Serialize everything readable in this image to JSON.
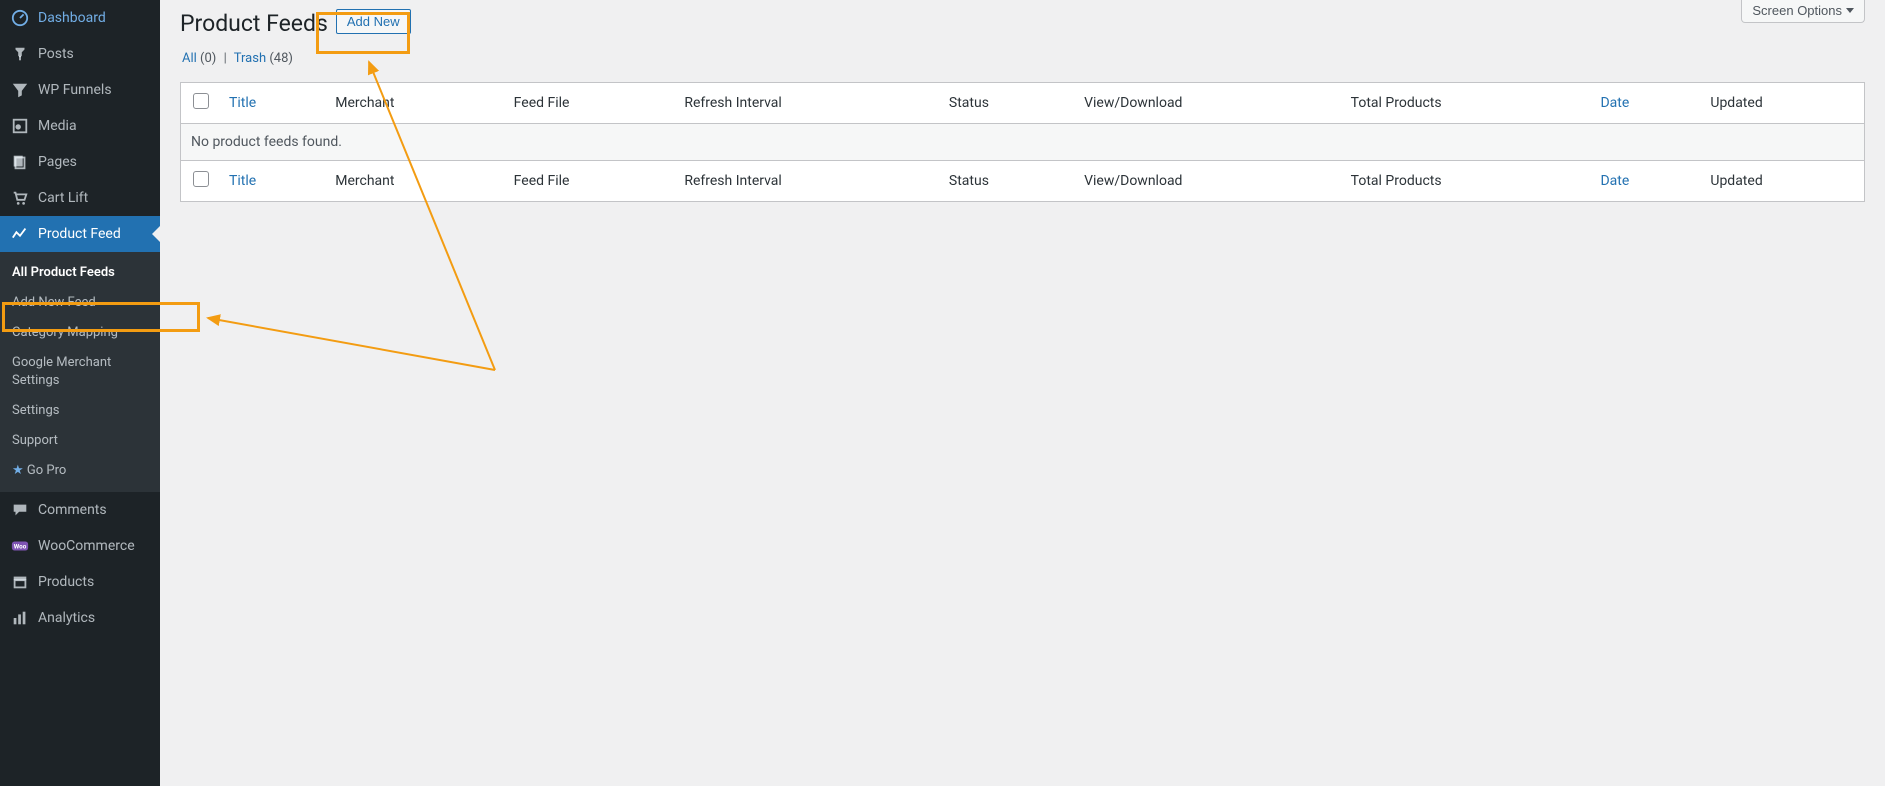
{
  "sidebar": {
    "items": [
      {
        "id": "dashboard",
        "label": "Dashboard",
        "icon": "dashboard"
      },
      {
        "id": "posts",
        "label": "Posts",
        "icon": "pushpin"
      },
      {
        "id": "wpfunnels",
        "label": "WP Funnels",
        "icon": "funnel"
      },
      {
        "id": "media",
        "label": "Media",
        "icon": "media"
      },
      {
        "id": "pages",
        "label": "Pages",
        "icon": "page"
      },
      {
        "id": "cartlift",
        "label": "Cart Lift",
        "icon": "cart"
      },
      {
        "id": "productfeed",
        "label": "Product Feed",
        "icon": "chart",
        "active": true
      },
      {
        "id": "comments",
        "label": "Comments",
        "icon": "comment"
      },
      {
        "id": "woocommerce",
        "label": "WooCommerce",
        "icon": "woo"
      },
      {
        "id": "products",
        "label": "Products",
        "icon": "archive"
      },
      {
        "id": "analytics",
        "label": "Analytics",
        "icon": "bars"
      }
    ],
    "submenu": [
      {
        "id": "all-feeds",
        "label": "All Product Feeds",
        "current": true
      },
      {
        "id": "add-new-feed",
        "label": "Add New Feed"
      },
      {
        "id": "category-mapping",
        "label": "Category Mapping"
      },
      {
        "id": "google-merchant",
        "label": "Google Merchant Settings"
      },
      {
        "id": "settings",
        "label": "Settings"
      },
      {
        "id": "support",
        "label": "Support"
      },
      {
        "id": "gopro",
        "label": "Go Pro",
        "star": true
      }
    ]
  },
  "header": {
    "title": "Product Feeds",
    "add_new_label": "Add New",
    "screen_options_label": "Screen Options"
  },
  "filters": {
    "all_label": "All",
    "all_count": "(0)",
    "trash_label": "Trash",
    "trash_count": "(48)",
    "sep": "|"
  },
  "table": {
    "columns": {
      "title": "Title",
      "merchant": "Merchant",
      "feed_file": "Feed File",
      "refresh": "Refresh Interval",
      "status": "Status",
      "view_download": "View/Download",
      "total_products": "Total Products",
      "date": "Date",
      "updated": "Updated"
    },
    "empty_message": "No product feeds found."
  }
}
